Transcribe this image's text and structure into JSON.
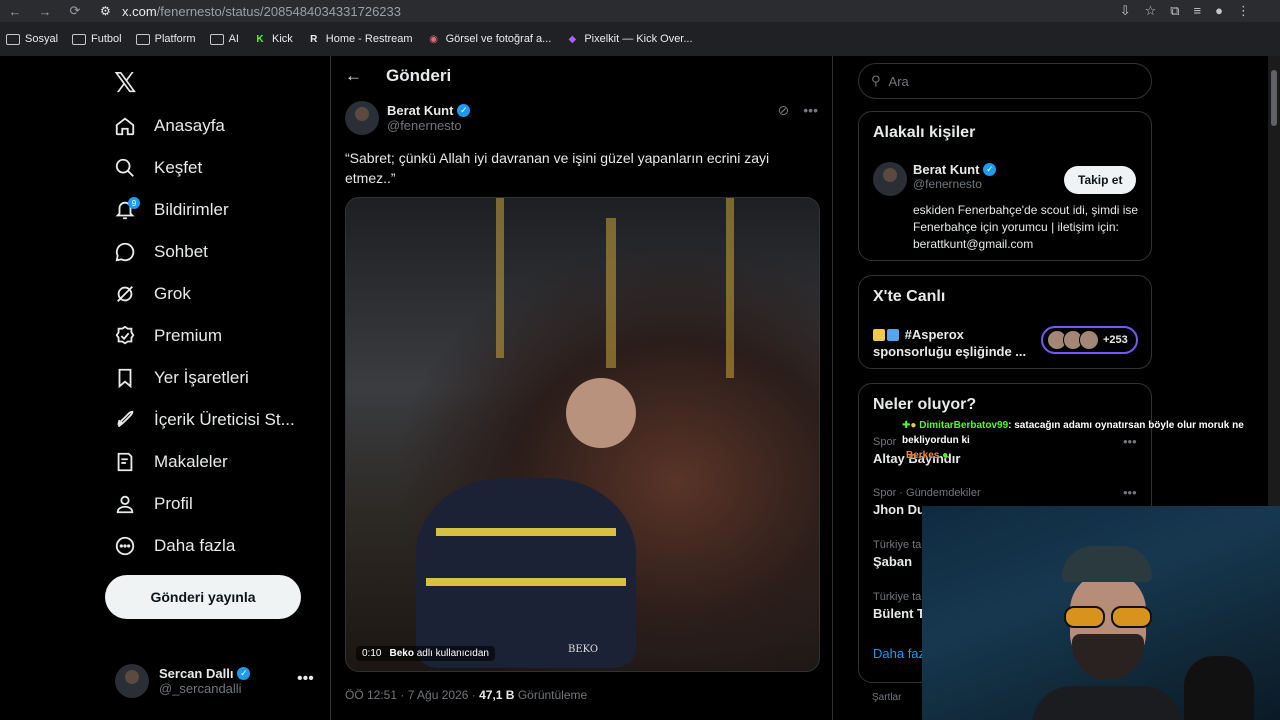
{
  "browser": {
    "url_host": "x.com",
    "url_path": "/fenernesto/status/2085484034331726233",
    "bookmarks": [
      {
        "label": "Sosyal",
        "icon": "folder-icon"
      },
      {
        "label": "Futbol",
        "icon": "folder-icon"
      },
      {
        "label": "Platform",
        "icon": "folder-icon"
      },
      {
        "label": "AI",
        "icon": "folder-icon"
      },
      {
        "label": "Kick",
        "icon": "kick-icon"
      },
      {
        "label": "Home - Restream",
        "icon": "restream-icon"
      },
      {
        "label": "Görsel ve fotoğraf a...",
        "icon": "image-icon"
      },
      {
        "label": "Pixelkit — Kick Over...",
        "icon": "pixelkit-icon"
      }
    ]
  },
  "sidebar": {
    "logo": "𝕏",
    "items": [
      {
        "label": "Anasayfa",
        "icon": "home-icon"
      },
      {
        "label": "Keşfet",
        "icon": "search-icon"
      },
      {
        "label": "Bildirimler",
        "icon": "bell-icon",
        "badge": "9"
      },
      {
        "label": "Sohbet",
        "icon": "chat-icon"
      },
      {
        "label": "Grok",
        "icon": "grok-icon"
      },
      {
        "label": "Premium",
        "icon": "premium-icon"
      },
      {
        "label": "Yer İşaretleri",
        "icon": "bookmark-icon"
      },
      {
        "label": "İçerik Üreticisi St...",
        "icon": "rocket-icon"
      },
      {
        "label": "Makaleler",
        "icon": "article-icon"
      },
      {
        "label": "Profil",
        "icon": "profile-icon"
      },
      {
        "label": "Daha fazla",
        "icon": "more-circle-icon"
      }
    ],
    "post_button": "Gönderi yayınla",
    "account": {
      "name": "Sercan Dallı",
      "handle": "@_sercandalli"
    }
  },
  "main": {
    "header": "Gönderi",
    "tweet": {
      "author_name": "Berat Kunt",
      "author_handle": "@fenernesto",
      "text": "“Sabret; çünkü Allah iyi davranan ve işini güzel yapanların ecrini zayi etmez..”",
      "video_time": "0:10",
      "video_source_user": "Beko",
      "video_source_suffix": "adlı kullanıcıdan",
      "video_ad_text": "BEKO",
      "timestamp": "ÖÖ 12:51 · 7 Ağu 2026 ·",
      "views_value": "47,1 B",
      "views_label": "Görüntüleme"
    }
  },
  "right": {
    "search_placeholder": "Ara",
    "related": {
      "title": "Alakalı kişiler",
      "name": "Berat Kunt",
      "handle": "@fenernesto",
      "follow_label": "Takip et",
      "bio": "eskiden Fenerbahçe'de scout idi, şimdi ise Fenerbahçe için yorumcu | iletişim için: berattkunt@gmail.com"
    },
    "live": {
      "title": "X'te Canlı",
      "topic": "#Asperox sponsorluğu eşliğinde ...",
      "count": "+253"
    },
    "trends": {
      "title": "Neler oluyor?",
      "items": [
        {
          "category": "Spor",
          "name": "Altay Bayındır"
        },
        {
          "category": "Spor · Gündemdekiler",
          "name": "Jhon Du"
        },
        {
          "category": "Türkiye ta",
          "name": "Şaban"
        },
        {
          "category": "Türkiye ta",
          "name": "Bülent T"
        }
      ],
      "show_more": "Daha faz"
    },
    "footer": "Şartlar"
  },
  "overlay": {
    "chat_user": "DimitarBerbatov99",
    "chat_message": ": satacağın adamı oynatırsan böyle olur moruk ne bekliyordun ki",
    "chat_user2": "Berkes"
  },
  "colors": {
    "accent": "#1d9bf0",
    "background": "#000000",
    "live_ring": "#7856ff"
  }
}
